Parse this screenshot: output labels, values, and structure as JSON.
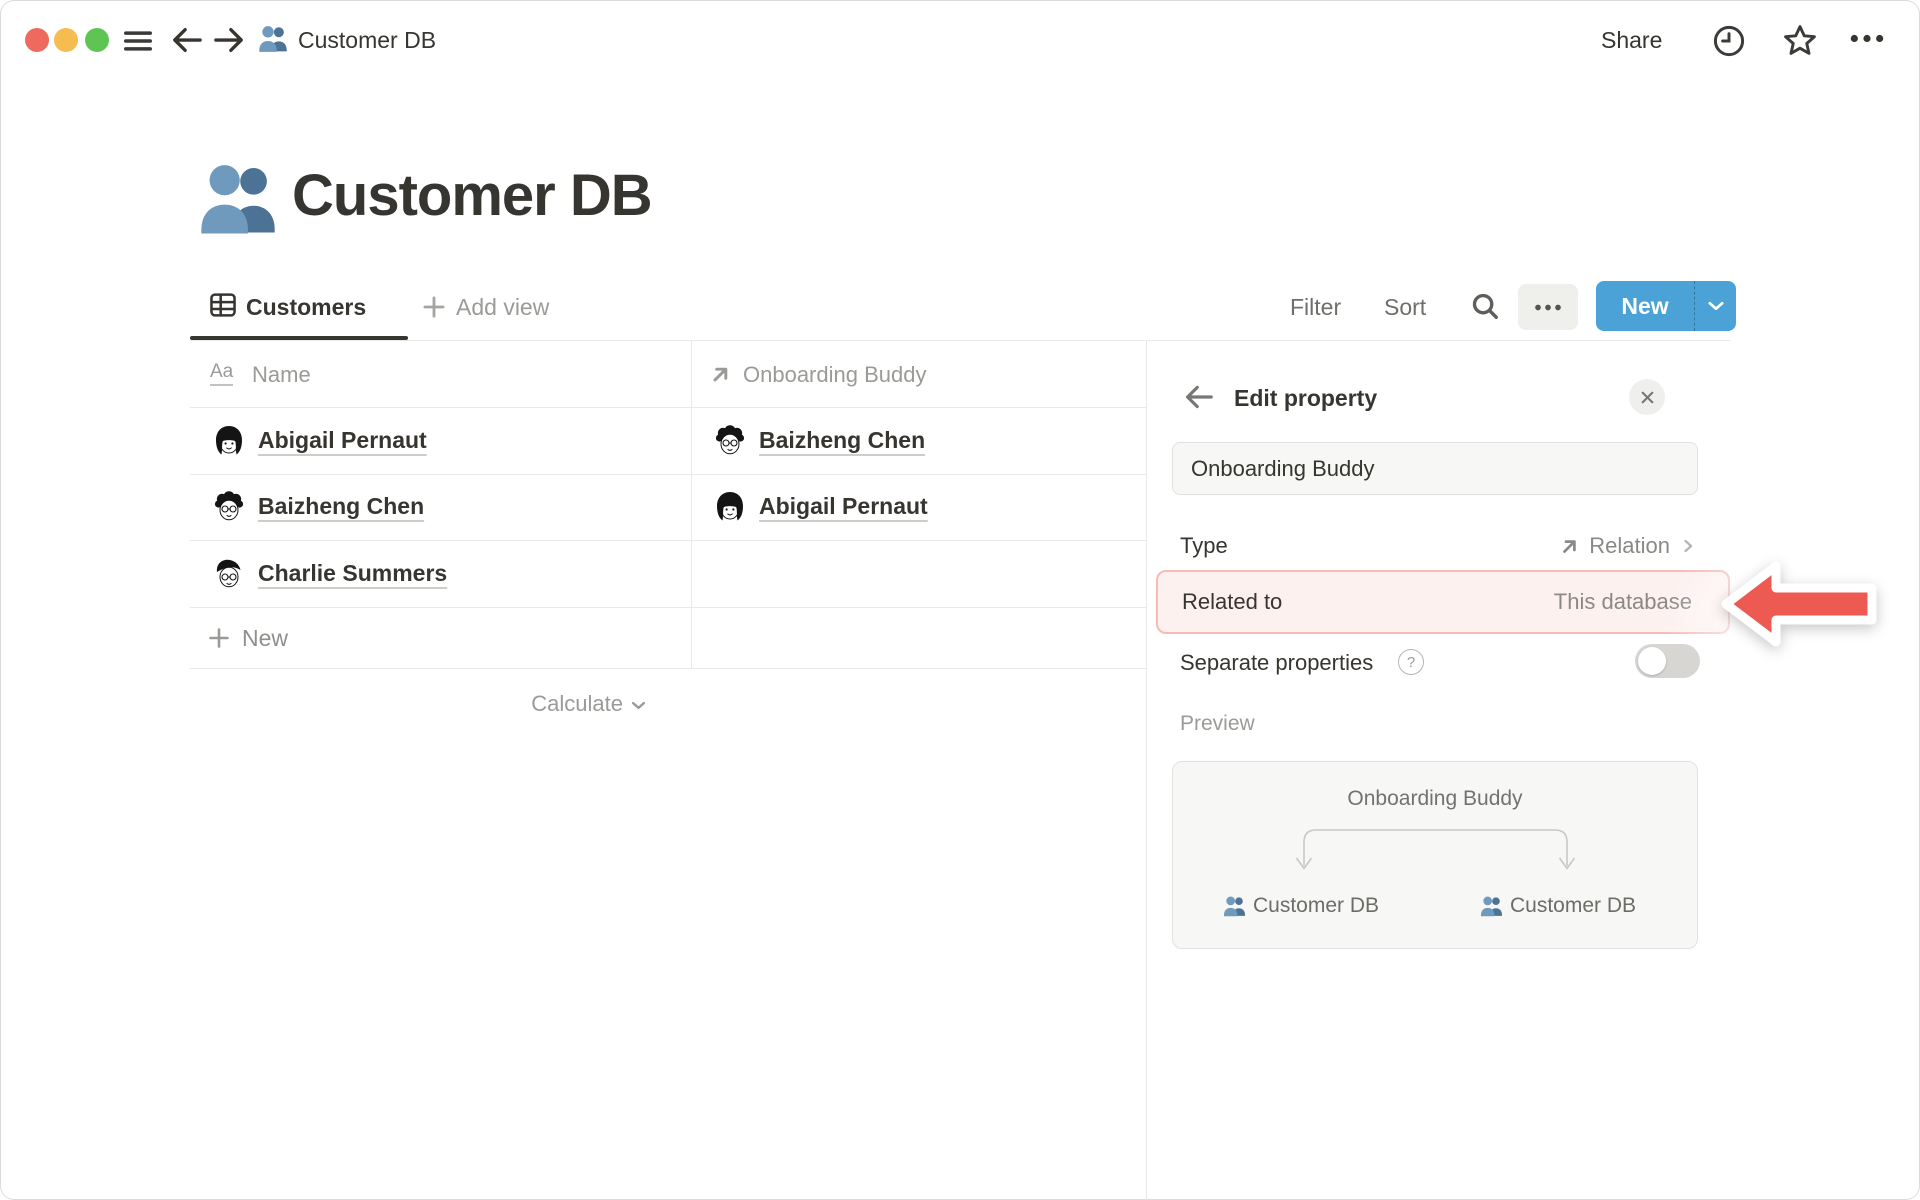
{
  "window": {
    "breadcrumb": "Customer DB"
  },
  "topbar": {
    "share_label": "Share"
  },
  "title": {
    "text": "Customer DB"
  },
  "toolbar": {
    "tab_label": "Customers",
    "add_view_label": "Add view",
    "filter_label": "Filter",
    "sort_label": "Sort",
    "new_label": "New"
  },
  "table": {
    "columns": [
      {
        "name": "Name"
      },
      {
        "name": "Onboarding Buddy"
      }
    ],
    "rows": [
      {
        "name": "Abigail Pernaut",
        "name_avatar": "#av-abigail",
        "buddy": "Baizheng Chen",
        "buddy_avatar": "#av-baizheng"
      },
      {
        "name": "Baizheng Chen",
        "name_avatar": "#av-baizheng",
        "buddy": "Abigail Pernaut",
        "buddy_avatar": "#av-abigail"
      },
      {
        "name": "Charlie Summers",
        "name_avatar": "#av-charlie",
        "buddy": "",
        "buddy_avatar": ""
      }
    ],
    "new_row_label": "New",
    "calculate_label": "Calculate",
    "aa_glyph": "Aa"
  },
  "panel": {
    "title": "Edit property",
    "name_value": "Onboarding Buddy",
    "type_label": "Type",
    "type_value": "Relation",
    "related_label": "Related to",
    "related_value": "This database",
    "separate_label": "Separate properties",
    "help_glyph": "?",
    "preview_label": "Preview",
    "preview": {
      "property": "Onboarding Buddy",
      "left_db": "Customer DB",
      "right_db": "Customer DB"
    }
  },
  "icons": {
    "breadcrumb": "people-icon",
    "tab": "table-icon",
    "name_column": "text-aa-icon",
    "relation_column": "arrow-up-right-icon",
    "highlight_pointer": "red-arrow-left"
  },
  "colors": {
    "accent_blue": "#4aa2d7",
    "highlight_pink_bg": "#fdf1f0",
    "highlight_pink_border": "#f3bcb6",
    "arrow_red": "#ec5a52",
    "text_dark": "#37352f",
    "text_gray": "#9b9a97"
  }
}
